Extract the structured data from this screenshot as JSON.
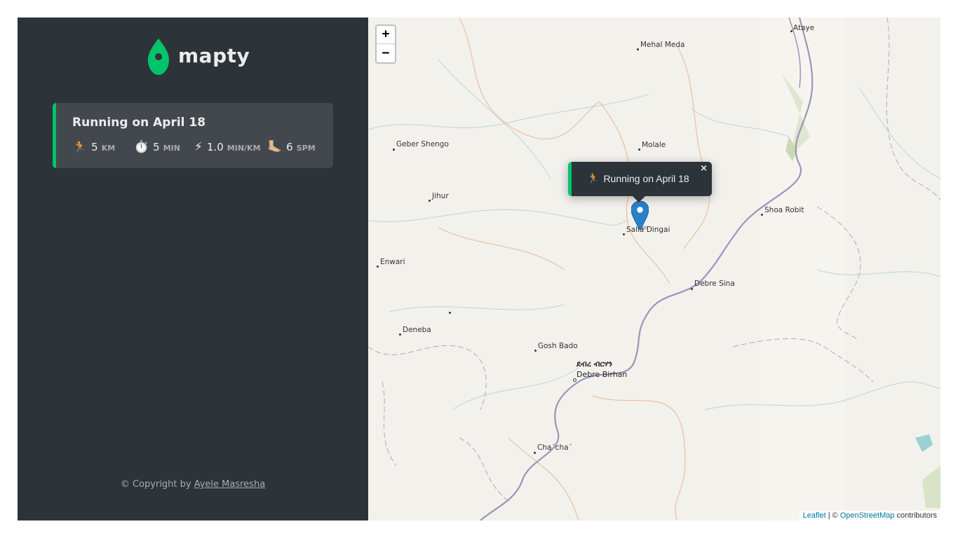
{
  "brand": {
    "name": "mapty",
    "logo_icon": "map-pin-logo-icon",
    "accent": "#00c46a"
  },
  "workouts": [
    {
      "title": "Running on April 18",
      "type": "running",
      "stats": [
        {
          "icon": "🏃",
          "icon_name": "runner-icon",
          "value": "5",
          "unit": "km"
        },
        {
          "icon": "⏱️",
          "icon_name": "stopwatch-icon",
          "value": "5",
          "unit": "min"
        },
        {
          "icon": "⚡",
          "icon_name": "lightning-icon",
          "value": "1.0",
          "unit": "min/km"
        },
        {
          "icon": "🦶🏼",
          "icon_name": "foot-icon",
          "value": "6",
          "unit": "spm"
        }
      ]
    }
  ],
  "footer": {
    "prefix": "© Copyright by ",
    "author": "Ayele Masresha"
  },
  "map": {
    "zoom_in": "+",
    "zoom_out": "−",
    "popup": {
      "icon": "🏃",
      "text": "Running on April 18",
      "close": "×"
    },
    "places": [
      "Ataye",
      "Mehal Meda",
      "Molale",
      "Geber Shengo",
      "Jihur",
      "Shoa Robit",
      "Salla Dingai",
      "Enwari",
      "Debre Sina",
      "Deneba",
      "Gosh Bado",
      "ደብረ ብርሃን",
      "Debre Birhan",
      "Cha´cha´"
    ],
    "attribution": {
      "leaflet": "Leaflet",
      "sep": " | © ",
      "osm": "OpenStreetMap",
      "suffix": " contributors"
    }
  }
}
